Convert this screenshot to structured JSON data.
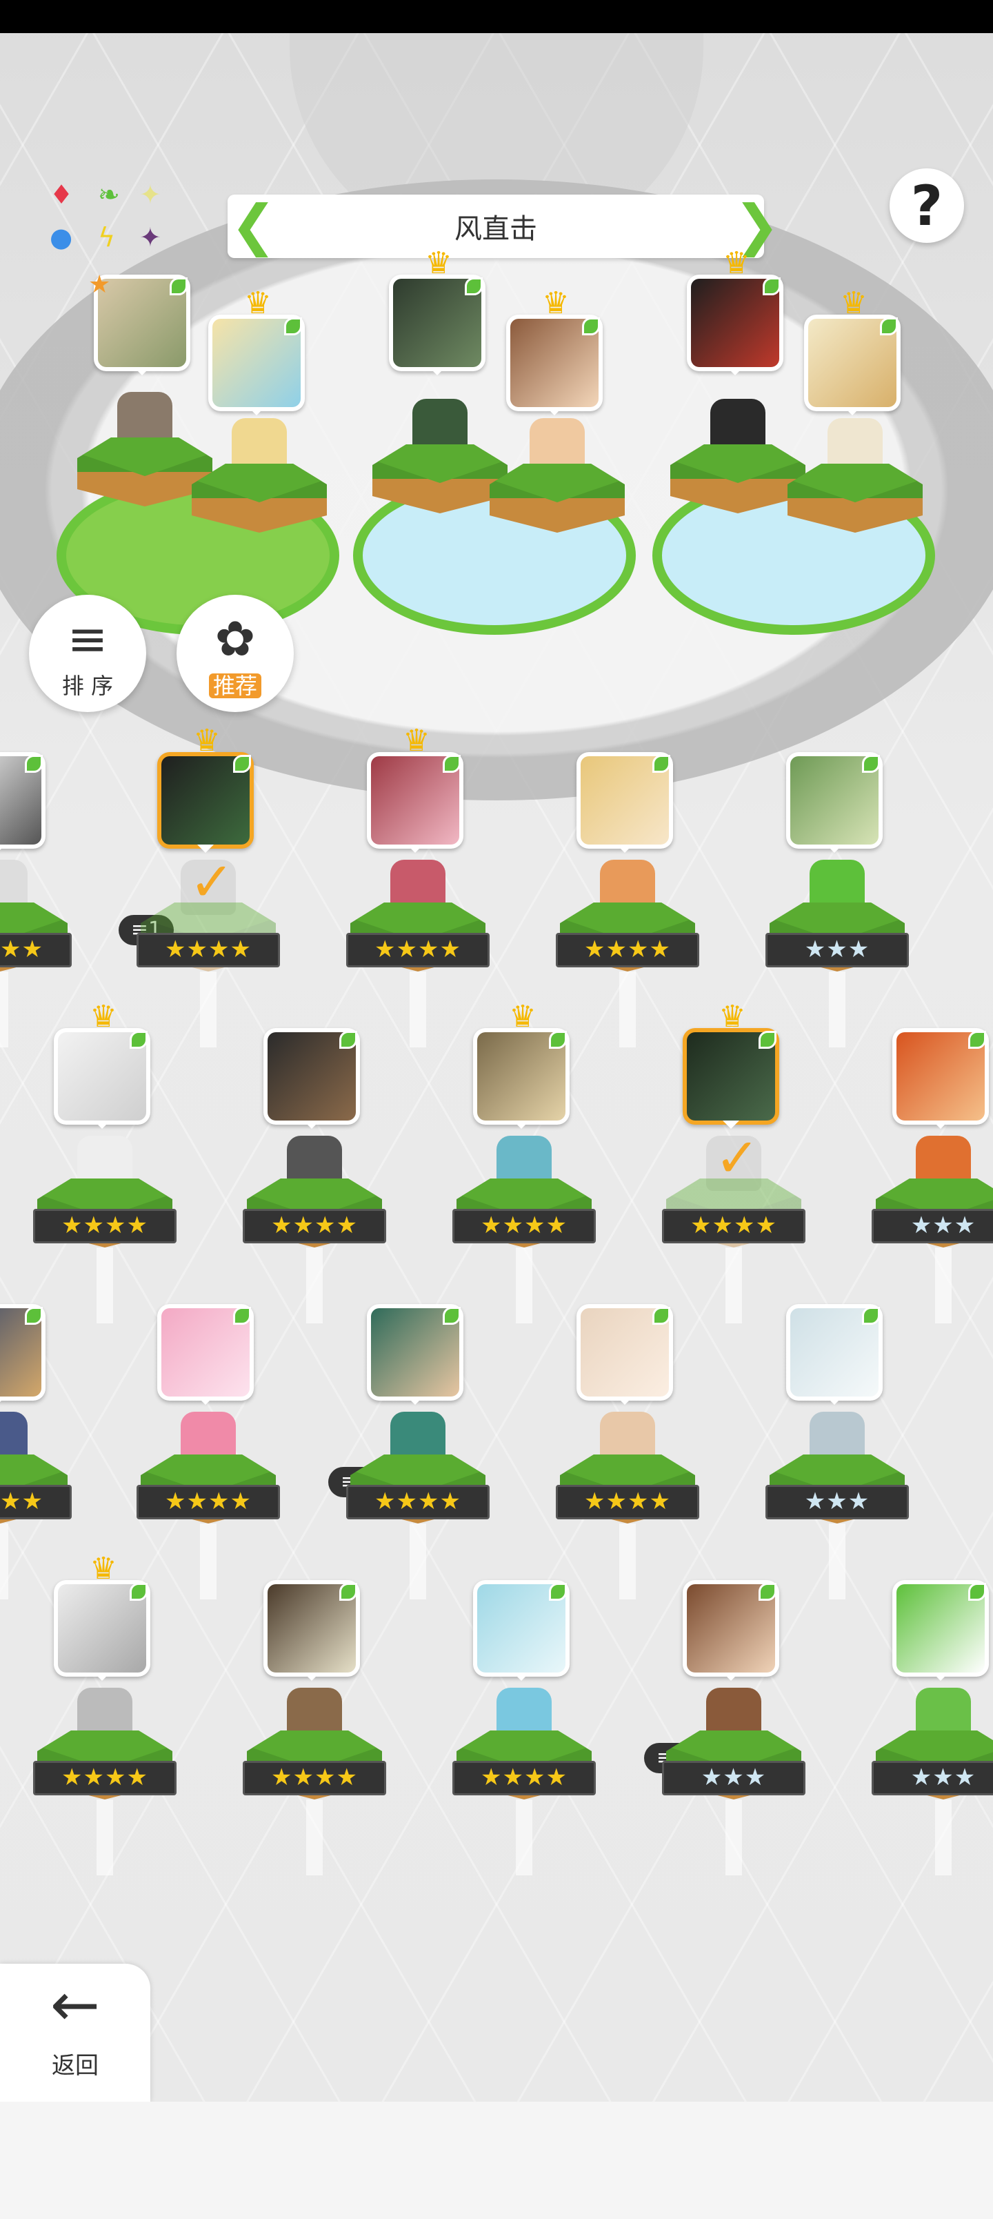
{
  "header": {
    "formation_title": "风直击"
  },
  "elements": [
    {
      "icon": "fire-icon",
      "glyph": "♦",
      "color": "#e6384a"
    },
    {
      "icon": "wind-icon",
      "glyph": "❧",
      "color": "#5dc03a"
    },
    {
      "icon": "light-icon",
      "glyph": "✦",
      "color": "#e6e28a"
    },
    {
      "icon": "water-icon",
      "glyph": "●",
      "color": "#3b8ee8"
    },
    {
      "icon": "thunder-icon",
      "glyph": "ϟ",
      "color": "#f0d020"
    },
    {
      "icon": "dark-icon",
      "glyph": "✦",
      "color": "#6a3a7a"
    }
  ],
  "buttons": {
    "help_label": "?",
    "sort_label": "排 序",
    "recommend_label": "推荐",
    "back_label": "返回"
  },
  "team": [
    {
      "role": "leader",
      "crown": false,
      "star_marker": true
    },
    {
      "role": "member",
      "crown": true
    },
    {
      "role": "member",
      "crown": true
    },
    {
      "role": "member",
      "crown": true
    },
    {
      "role": "member",
      "crown": true
    },
    {
      "role": "member",
      "crown": true
    }
  ],
  "roster": [
    {
      "row": 1,
      "stars": "★★★★",
      "rarity": "gold",
      "crown": true,
      "selected": true,
      "checked": true,
      "badge": "≡1"
    },
    {
      "row": 1,
      "stars": "★★★★",
      "rarity": "gold",
      "crown": true
    },
    {
      "row": 1,
      "stars": "★★★★",
      "rarity": "gold"
    },
    {
      "row": 1,
      "stars": "★★★",
      "rarity": "silver"
    },
    {
      "row": 2,
      "stars": "★★★★",
      "rarity": "gold",
      "crown": true
    },
    {
      "row": 2,
      "stars": "★★★★",
      "rarity": "gold"
    },
    {
      "row": 2,
      "stars": "★★★★",
      "rarity": "gold",
      "crown": true
    },
    {
      "row": 2,
      "stars": "★★★★",
      "rarity": "gold",
      "crown": true,
      "selected": true,
      "checked": true
    },
    {
      "row": 2,
      "stars": "★★★",
      "rarity": "silver"
    },
    {
      "row": 3,
      "stars": "★★★★",
      "rarity": "gold"
    },
    {
      "row": 3,
      "stars": "★★★★",
      "rarity": "gold",
      "badge": "≡1"
    },
    {
      "row": 3,
      "stars": "★★★★",
      "rarity": "gold"
    },
    {
      "row": 3,
      "stars": "★★★",
      "rarity": "silver"
    },
    {
      "row": 4,
      "stars": "★★★★",
      "rarity": "gold",
      "crown": true
    },
    {
      "row": 4,
      "stars": "★★★★",
      "rarity": "gold"
    },
    {
      "row": 4,
      "stars": "★★★★",
      "rarity": "gold"
    },
    {
      "row": 4,
      "stars": "★★★",
      "rarity": "silver",
      "badge": "≡2"
    },
    {
      "row": 4,
      "stars": "★★★",
      "rarity": "silver"
    }
  ],
  "colors": {
    "accent_green": "#6cc63c",
    "selected_orange": "#f5a623",
    "gold_star": "#f6c818",
    "silver_star": "#cfe6f2"
  }
}
